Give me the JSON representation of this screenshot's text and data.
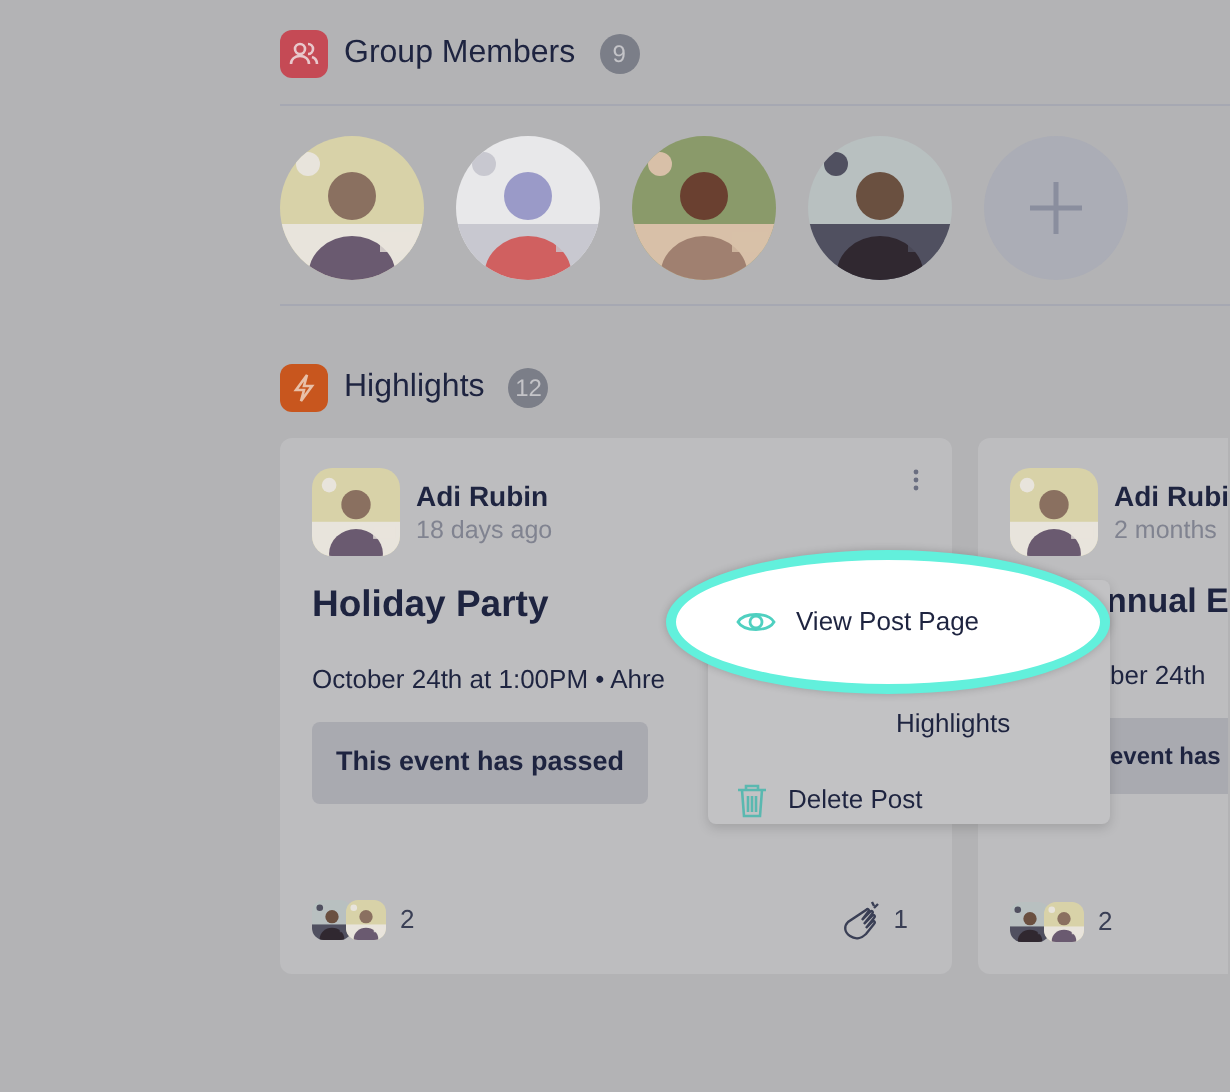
{
  "members": {
    "title": "Group Members",
    "count": "9",
    "add": {
      "kind": "add"
    }
  },
  "highlights": {
    "title": "Highlights",
    "count": "12",
    "cards": [
      {
        "author": "Adi Rubin",
        "time": "18 days ago",
        "title": "Holiday Party",
        "details": "October 24th at 1:00PM • Ahre",
        "status": "This event has passed",
        "reactions": "2",
        "claps": "1",
        "covered": false
      },
      {
        "author": "Adi Rubi",
        "time": "2 months",
        "title": "nnual E",
        "details": "ber 24th",
        "status": "event has",
        "reactions": "2",
        "covered": true
      }
    ]
  },
  "menu": {
    "items": [
      {
        "kind": "view",
        "label": "View Post Page",
        "selected": true
      },
      {
        "kind": "pin",
        "label": "Highlights",
        "selected": false
      },
      {
        "kind": "delete",
        "label": "Delete Post",
        "selected": false
      }
    ]
  }
}
